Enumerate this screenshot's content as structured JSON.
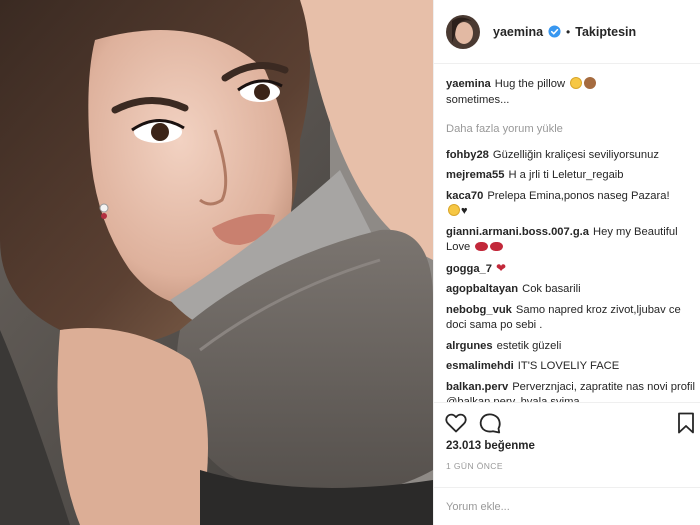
{
  "post": {
    "username": "yaemina",
    "follow_status": "Takiptesin",
    "separator": "•"
  },
  "caption": {
    "user": "yaemina",
    "text": "Hug the pillow",
    "text2": "sometimes..."
  },
  "load_more": "Daha fazla yorum yükle",
  "comments": [
    {
      "user": "fohby28",
      "text": "Güzelliğin kraliçesi seviliyorsunuz"
    },
    {
      "user": "mejrema55",
      "text": "H a jrli ti Leletur_regaib"
    },
    {
      "user": "kaca70",
      "text": "Prelepa Emina,ponos naseg Pazara!"
    },
    {
      "user": "gianni.armani.boss.007.g.a",
      "text": "Hey my Beautiful Love"
    },
    {
      "user": "gogga_7",
      "text": ""
    },
    {
      "user": "agopbaltayan",
      "text": "Cok basarili"
    },
    {
      "user": "nebobg_vuk",
      "text": "Samo napred kroz zivot,ljubav ce doci sama po sebi ."
    },
    {
      "user": "alrgunes",
      "text": "estetik güzeli"
    },
    {
      "user": "esmalimehdi",
      "text": "IT'S LOVELIY FACE"
    },
    {
      "user": "balkan.perv",
      "text": "Perverznjaci, zapratite nas novi profil @balkan.perv. hvala svima"
    }
  ],
  "likes": "23.013 beğenme",
  "time_ago": "1 GÜN ÖNCE",
  "add_comment_placeholder": "Yorum ekle...",
  "icons": {
    "like": "heart-outline-icon",
    "comment": "comment-bubble-icon",
    "save": "bookmark-icon",
    "verified": "verified-badge-icon"
  },
  "colors": {
    "text": "#262626",
    "muted": "#999999",
    "verified": "#3897f0",
    "border": "#efefef"
  }
}
